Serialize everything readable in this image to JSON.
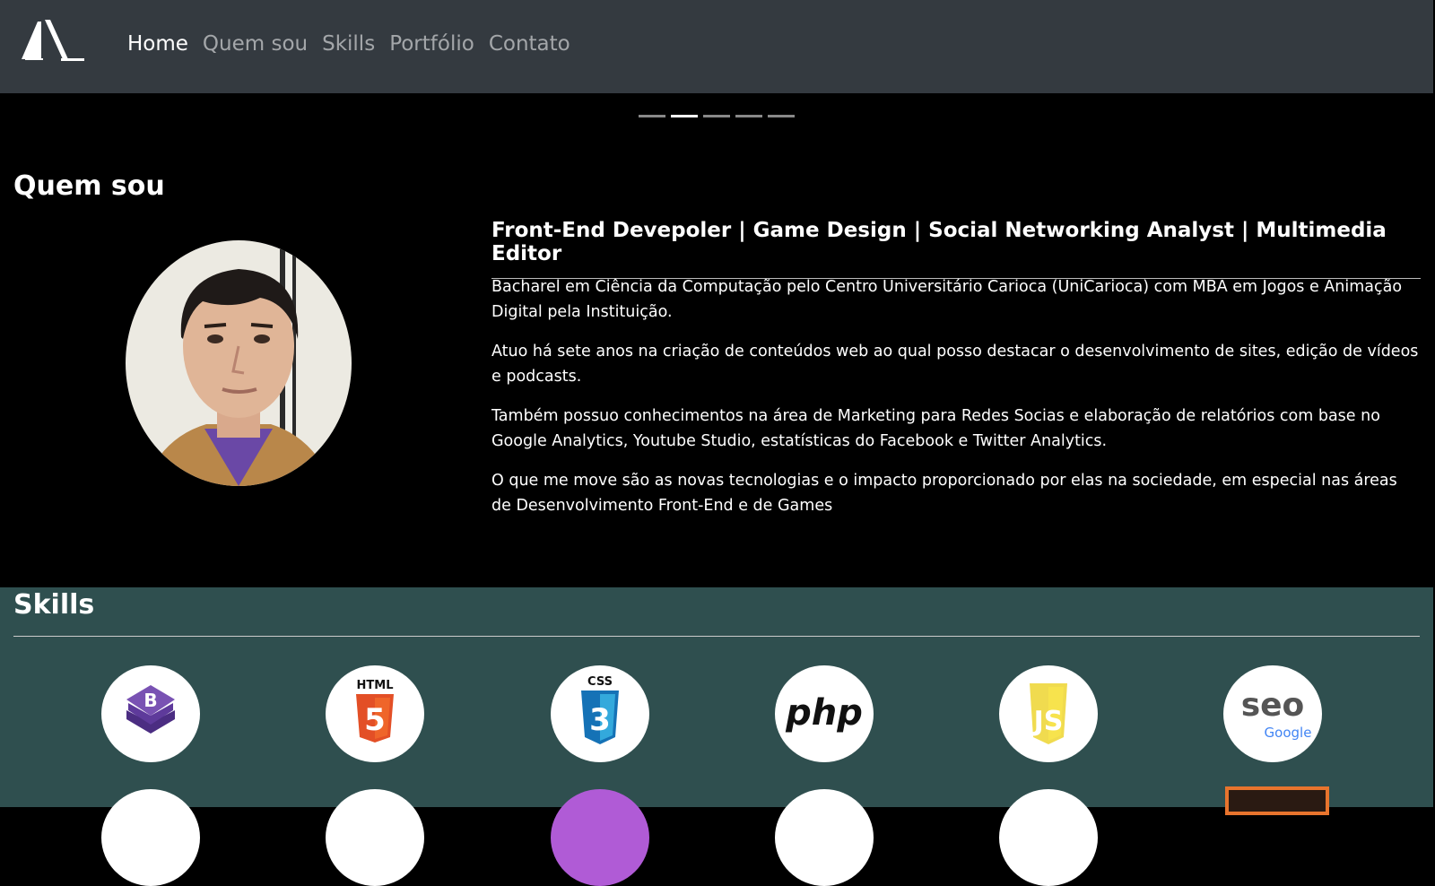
{
  "nav": {
    "logo_alt": "AL logo",
    "items": [
      {
        "label": "Home",
        "active": true
      },
      {
        "label": "Quem sou",
        "active": false
      },
      {
        "label": "Skills",
        "active": false
      },
      {
        "label": "Portfólio",
        "active": false
      },
      {
        "label": "Contato",
        "active": false
      }
    ]
  },
  "carousel": {
    "count": 5,
    "active_index": 1
  },
  "about": {
    "title": "Quem sou",
    "headline": "Front-End Devepoler | Game Design | Social Networking Analyst | Multimedia Editor",
    "paragraphs": [
      "Bacharel em Ciência da Computação pelo Centro Universitário Carioca (UniCarioca) com MBA em Jogos e Animação Digital pela Instituição.",
      "Atuo há sete anos na criação de conteúdos web ao qual posso destacar o desenvolvimento de sites, edição de vídeos e podcasts.",
      "Também possuo conhecimentos na área de Marketing para Redes Socias e elaboração de relatórios com base no Google Analytics, Youtube Studio, estatísticas do Facebook e Twitter Analytics.",
      "O que me move são as novas tecnologias e o impacto proporcionado por elas na sociedade, em especial nas áreas de Desenvolvimento Front-End e de Games"
    ]
  },
  "skills": {
    "title": "Skills",
    "icons": [
      {
        "name": "bootstrap-icon",
        "text": "B"
      },
      {
        "name": "html5-icon",
        "text": "HTML",
        "badge": "5"
      },
      {
        "name": "css3-icon",
        "text": "CSS",
        "badge": "3"
      },
      {
        "name": "php-icon",
        "text": "php"
      },
      {
        "name": "javascript-icon",
        "text": "JS"
      },
      {
        "name": "seo-google-icon",
        "text": "seo",
        "sub": "Google"
      }
    ]
  },
  "colors": {
    "navbar": "#343a40",
    "skills_bg": "#2f4f4f",
    "bootstrap": "#7952b3",
    "html": "#e34f26",
    "css": "#1572b6",
    "js": "#f0db4f"
  }
}
